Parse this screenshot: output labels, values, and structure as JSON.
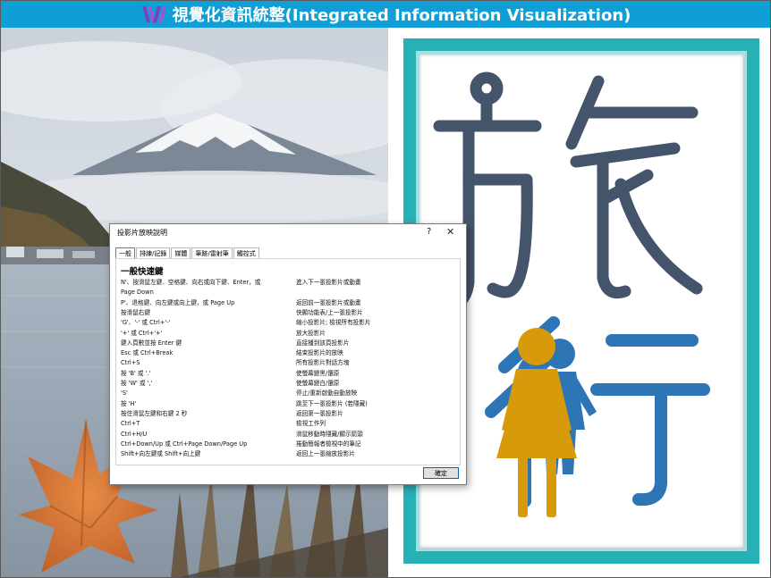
{
  "header": {
    "title": "視覺化資訊統整(Integrated Information Visualization)"
  },
  "poster": {
    "char_top": "旅",
    "char_bottom": "行",
    "colors": {
      "frame": "#27b0b5",
      "char_top": "#44546a",
      "char_bottom": "#2e75b6",
      "figure_front": "#d79a0b",
      "figure_back": "#2e75b6"
    }
  },
  "dialog": {
    "title": "投影片放映說明",
    "help": "?",
    "close": "✕",
    "tabs": [
      "一般",
      "排練/記錄",
      "媒體",
      "筆跡/雷射筆",
      "觸控式"
    ],
    "section_title": "一般快速鍵",
    "shortcuts": [
      {
        "keys": "N'、按滑鼠左鍵、空格鍵、向右或向下鍵、Enter，或",
        "desc": "進入下一張投影片或動畫"
      },
      {
        "keys": "Page Down",
        "desc": ""
      },
      {
        "keys": "P'、退格鍵、向左鍵或向上鍵，或 Page Up",
        "desc": "返回前一張投影片或動畫"
      },
      {
        "keys": "按滑鼠右鍵",
        "desc": "快顯功能表/上一張投影片"
      },
      {
        "keys": "'G'、'-' 或 Ctrl+'-'",
        "desc": "縮小投影片; 檢視所有投影片"
      },
      {
        "keys": "'+' 或 Ctrl+'+'",
        "desc": "放大投影片"
      },
      {
        "keys": "鍵入頁數並按 Enter 鍵",
        "desc": "直接播到該頁投影片"
      },
      {
        "keys": "Esc 或 Ctrl+Break",
        "desc": "結束投影片的放映"
      },
      {
        "keys": "Ctrl+S",
        "desc": "所有投影片對話方塊"
      },
      {
        "keys": "按 'B' 或 '.'",
        "desc": "使螢幕變黑/還原"
      },
      {
        "keys": "按 'W' 或 ','",
        "desc": "使螢幕變白/還原"
      },
      {
        "keys": "'S'",
        "desc": "停止/重新啟動自動放映"
      },
      {
        "keys": "按 'H'",
        "desc": "跳至下一張投影片 (若隱藏)"
      },
      {
        "keys": "按住滑鼠左鍵和右鍵 2 秒",
        "desc": "返回第一張投影片"
      },
      {
        "keys": "Ctrl+T",
        "desc": "檢視工作列"
      },
      {
        "keys": "Ctrl+H/U",
        "desc": "滑鼠移動時隱藏/顯示箭頭"
      },
      {
        "keys": "Ctrl+Down/Up 或 Ctrl+Page Down/Page Up",
        "desc": "捲動簡報者檢視中的筆記"
      },
      {
        "keys": "Shift+向左鍵或 Shift+向上鍵",
        "desc": "返回上一張縮放投影片"
      }
    ],
    "ok_label": "確定"
  }
}
